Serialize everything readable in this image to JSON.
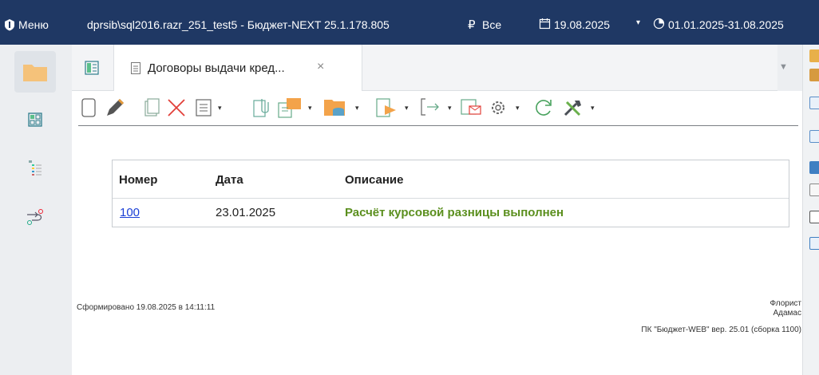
{
  "titlebar": {
    "menu_label": "Меню",
    "server_title": "dprsib\\sql2016.razr_251_test5 - Бюджет-NEXT 25.1.178.805",
    "currency_symbol": "₽",
    "currency_label": "Все",
    "date": "19.08.2025",
    "period": "01.01.2025-31.08.2025"
  },
  "tabs": [
    {
      "label": "Договоры выдачи кред...",
      "close": "×"
    }
  ],
  "table": {
    "headers": [
      "Номер",
      "Дата",
      "Описание"
    ],
    "rows": [
      {
        "number": "100",
        "date": "23.01.2025",
        "description": "Расчёт курсовой разницы выполнен"
      }
    ]
  },
  "footer": {
    "generated": "Сформировано 19.08.2025 в 14:11:11",
    "user_line1": "Флорист",
    "user_line2": "Адамас",
    "version": "ПК \"Бюджет-WEB\" вер. 25.01 (сборка 1100)"
  },
  "colors": {
    "titlebar_bg": "#1f3864",
    "status_green": "#5b8f1e",
    "link_blue": "#1a3fd6",
    "folder_orange": "#f5c27a"
  }
}
